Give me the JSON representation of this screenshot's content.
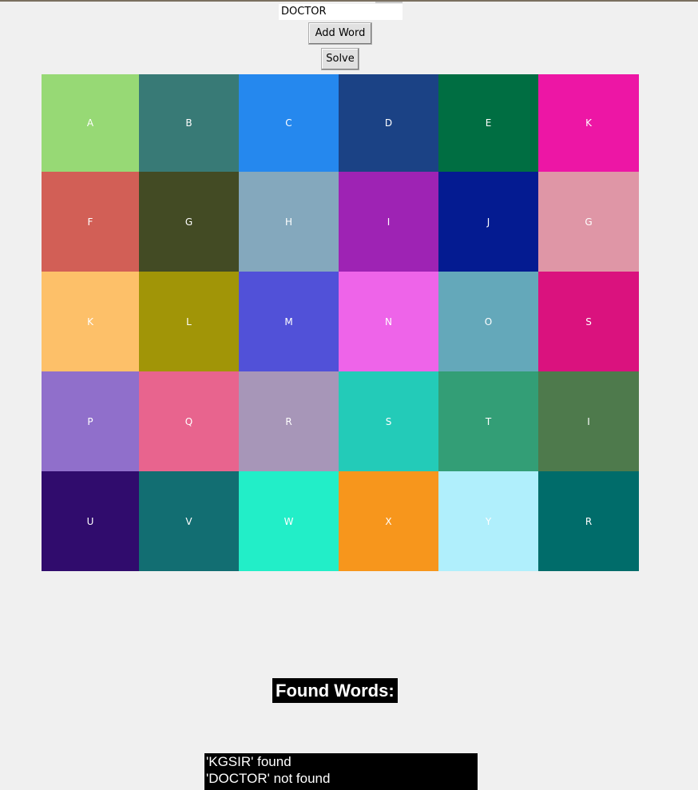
{
  "input": {
    "value": "DOCTOR"
  },
  "buttons": {
    "add_word": "Add Word",
    "solve": "Solve"
  },
  "grid": {
    "rows": [
      [
        {
          "letter": "A",
          "color": "#97d975"
        },
        {
          "letter": "B",
          "color": "#387a76"
        },
        {
          "letter": "C",
          "color": "#2588ee"
        },
        {
          "letter": "D",
          "color": "#1b4285"
        },
        {
          "letter": "E",
          "color": "#006e42"
        },
        {
          "letter": "K",
          "color": "#ed16a5"
        }
      ],
      [
        {
          "letter": "F",
          "color": "#d25f56"
        },
        {
          "letter": "G",
          "color": "#434b24"
        },
        {
          "letter": "H",
          "color": "#84a8bd"
        },
        {
          "letter": "I",
          "color": "#9e23b4"
        },
        {
          "letter": "J",
          "color": "#041b91"
        },
        {
          "letter": "G",
          "color": "#df96a6"
        }
      ],
      [
        {
          "letter": "K",
          "color": "#fdc069"
        },
        {
          "letter": "L",
          "color": "#a19507"
        },
        {
          "letter": "M",
          "color": "#5151d8"
        },
        {
          "letter": "N",
          "color": "#ee64e9"
        },
        {
          "letter": "O",
          "color": "#64a8ba"
        },
        {
          "letter": "S",
          "color": "#da127e"
        }
      ],
      [
        {
          "letter": "P",
          "color": "#906fcb"
        },
        {
          "letter": "Q",
          "color": "#e8648e"
        },
        {
          "letter": "R",
          "color": "#a796b8"
        },
        {
          "letter": "S",
          "color": "#23cbb8"
        },
        {
          "letter": "T",
          "color": "#339e76"
        },
        {
          "letter": "I",
          "color": "#4e7a4c"
        }
      ],
      [
        {
          "letter": "U",
          "color": "#300c6d"
        },
        {
          "letter": "V",
          "color": "#126e72"
        },
        {
          "letter": "W",
          "color": "#22eec8"
        },
        {
          "letter": "X",
          "color": "#f7961c"
        },
        {
          "letter": "Y",
          "color": "#b0effc"
        },
        {
          "letter": "R",
          "color": "#006c6a"
        }
      ]
    ]
  },
  "found_words": {
    "title": "Found Words:",
    "results": [
      "'KGSIR' found",
      "'DOCTOR' not found"
    ]
  }
}
